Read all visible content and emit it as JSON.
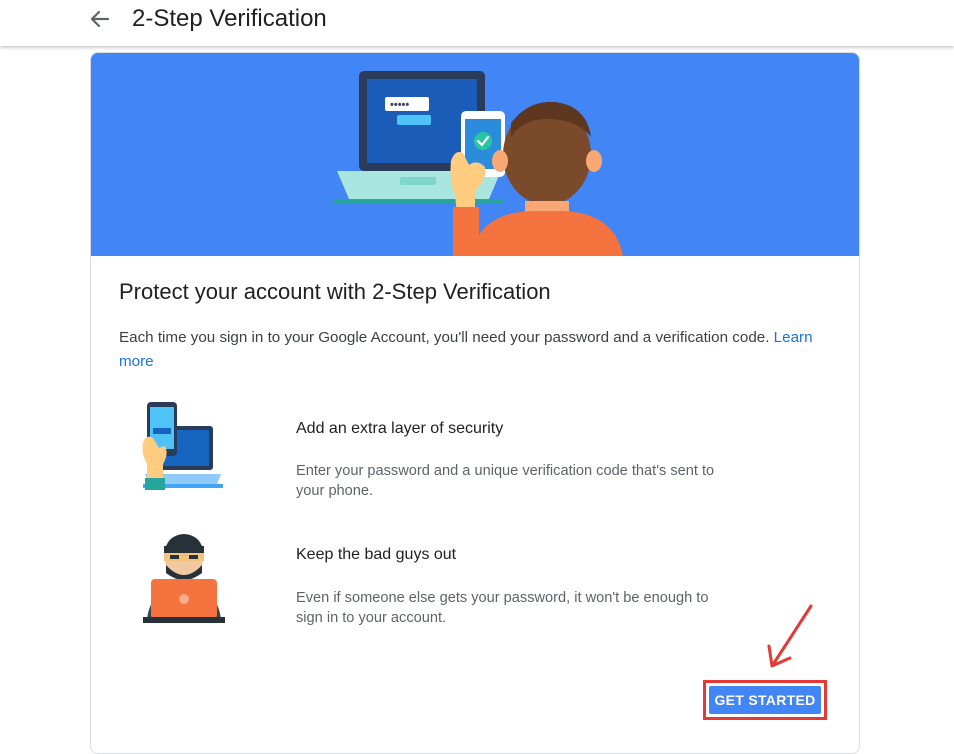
{
  "header": {
    "back_icon": "arrow-back-icon",
    "title": "2-Step Verification"
  },
  "hero": {
    "illustration": "person-laptop-phone-illustration",
    "password_mask": "•••••"
  },
  "card": {
    "heading": "Protect your account with 2-Step Verification",
    "intro_text": "Each time you sign in to your Google Account, you'll need your password and a verification code.",
    "learn_more": "Learn more"
  },
  "features": [
    {
      "icon": "phone-laptop-illustration",
      "title": "Add an extra layer of security",
      "description": "Enter your password and a unique verification code that's sent to your phone."
    },
    {
      "icon": "hacker-illustration",
      "title": "Keep the bad guys out",
      "description": "Even if someone else gets your password, it won't be enough to sign in to your account."
    }
  ],
  "actions": {
    "get_started": "GET STARTED"
  },
  "annotation": {
    "icon": "red-arrow-icon"
  },
  "colors": {
    "hero_blue": "#4285f4",
    "button_blue": "#4285f4",
    "link_blue": "#1a73e8",
    "highlight_red": "#e53935",
    "shirt_orange": "#f4733e"
  }
}
